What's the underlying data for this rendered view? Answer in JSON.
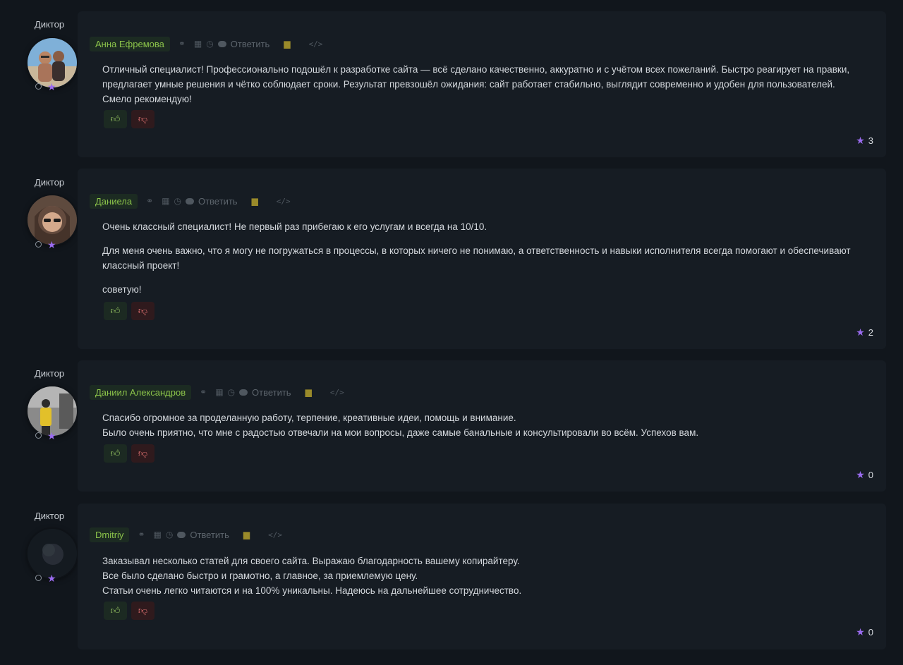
{
  "comments": [
    {
      "role": "Диктор",
      "author": "Анна Ефремова",
      "reply_label": "Ответить",
      "paragraphs": [
        "Отличный специалист! Профессионально подошёл к разработке сайта — всё сделано качественно, аккуратно и с учётом всех пожеланий. Быстро реагирует на правки, предлагает умные решения и чётко соблюдает сроки. Результат превзошёл ожидания: сайт работает стабильно, выглядит современно и удобен для пользователей. Смело рекомендую!"
      ],
      "rating": "3"
    },
    {
      "role": "Диктор",
      "author": "Даниела",
      "reply_label": "Ответить",
      "paragraphs": [
        "Очень классный специалист! Не первый раз прибегаю к его услугам и всегда на 10/10.",
        "Для меня очень важно, что я могу не погружаться в процессы, в которых ничего не понимаю, а ответственность и навыки исполнителя всегда помогают и обеспечивают классный проект!",
        "советую!"
      ],
      "rating": "2"
    },
    {
      "role": "Диктор",
      "author": "Даниил Александров",
      "reply_label": "Ответить",
      "paragraphs": [
        "Спасибо огромное за проделанную работу, терпение, креативные идеи, помощь и внимание.",
        "Было очень приятно, что мне с радостью отвечали на мои вопросы, даже самые банальные и консультировали во всём. Успехов вам."
      ],
      "rating": "0"
    },
    {
      "role": "Диктор",
      "author": "Dmitriy",
      "reply_label": "Ответить",
      "paragraphs": [
        "Заказывал несколько статей для своего сайта. Выражаю благодарность вашему копирайтеру.",
        "Все было сделано быстро и грамотно, а главное, за приемлемую цену.",
        "Статьи очень легко читаются и на 100% уникальны. Надеюсь на дальнейшее сотрудничество."
      ],
      "rating": "0"
    }
  ],
  "icons": {
    "link": "link-icon",
    "calendar": "calendar-icon",
    "clock": "clock-icon",
    "reply": "comment-bubble-icon",
    "delete": "trash-icon",
    "embed": "code-icon",
    "like": "thumbs-up-icon",
    "dislike": "thumbs-down-icon",
    "rating": "star-icon"
  },
  "colors": {
    "background": "#11161c",
    "card": "#161c23",
    "author_text": "#8bc34a",
    "author_bg": "#1c2b22",
    "star": "#9b6cf0",
    "like": "#9ccc65",
    "dislike": "#e57373"
  }
}
